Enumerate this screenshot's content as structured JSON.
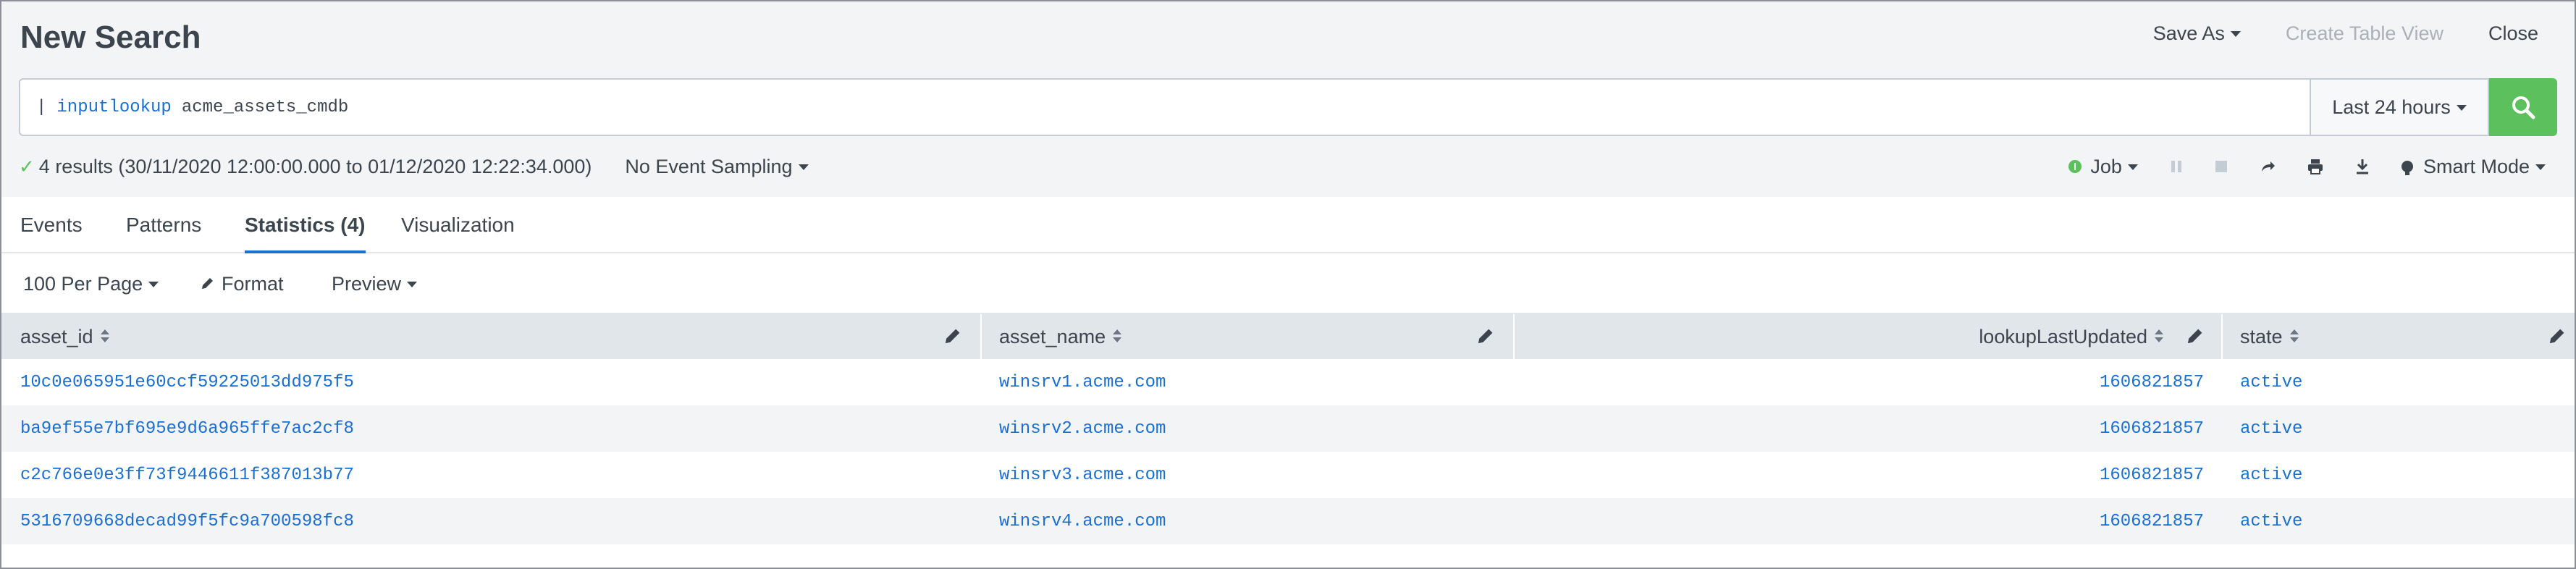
{
  "header": {
    "title": "New Search",
    "save_as": "Save As",
    "create_table_view": "Create Table View",
    "close": "Close"
  },
  "search": {
    "pipe": "|",
    "command": "inputlookup",
    "argument": "acme_assets_cmdb",
    "time_range": "Last 24 hours",
    "search_icon": "search-icon"
  },
  "status": {
    "results": "4 results (30/11/2020 12:00:00.000 to 01/12/2020 12:22:34.000)",
    "sampling": "No Event Sampling",
    "job": "Job",
    "mode": "Smart Mode"
  },
  "tabs": [
    {
      "label": "Events"
    },
    {
      "label": "Patterns"
    },
    {
      "label": "Statistics (4)"
    },
    {
      "label": "Visualization"
    }
  ],
  "controls": {
    "per_page": "100 Per Page",
    "format": "Format",
    "preview": "Preview"
  },
  "table": {
    "columns": [
      "asset_id",
      "asset_name",
      "lookupLastUpdated",
      "state"
    ],
    "rows": [
      [
        "10c0e065951e60ccf59225013dd975f5",
        "winsrv1.acme.com",
        "1606821857",
        "active"
      ],
      [
        "ba9ef55e7bf695e9d6a965ffe7ac2cf8",
        "winsrv2.acme.com",
        "1606821857",
        "active"
      ],
      [
        "c2c766e0e3ff73f9446611f387013b77",
        "winsrv3.acme.com",
        "1606821857",
        "active"
      ],
      [
        "5316709668decad99f5fc9a700598fc8",
        "winsrv4.acme.com",
        "1606821857",
        "active"
      ]
    ]
  },
  "colors": {
    "accent": "#1a6fcf",
    "success": "#5cc05c",
    "text": "#3c444d"
  }
}
